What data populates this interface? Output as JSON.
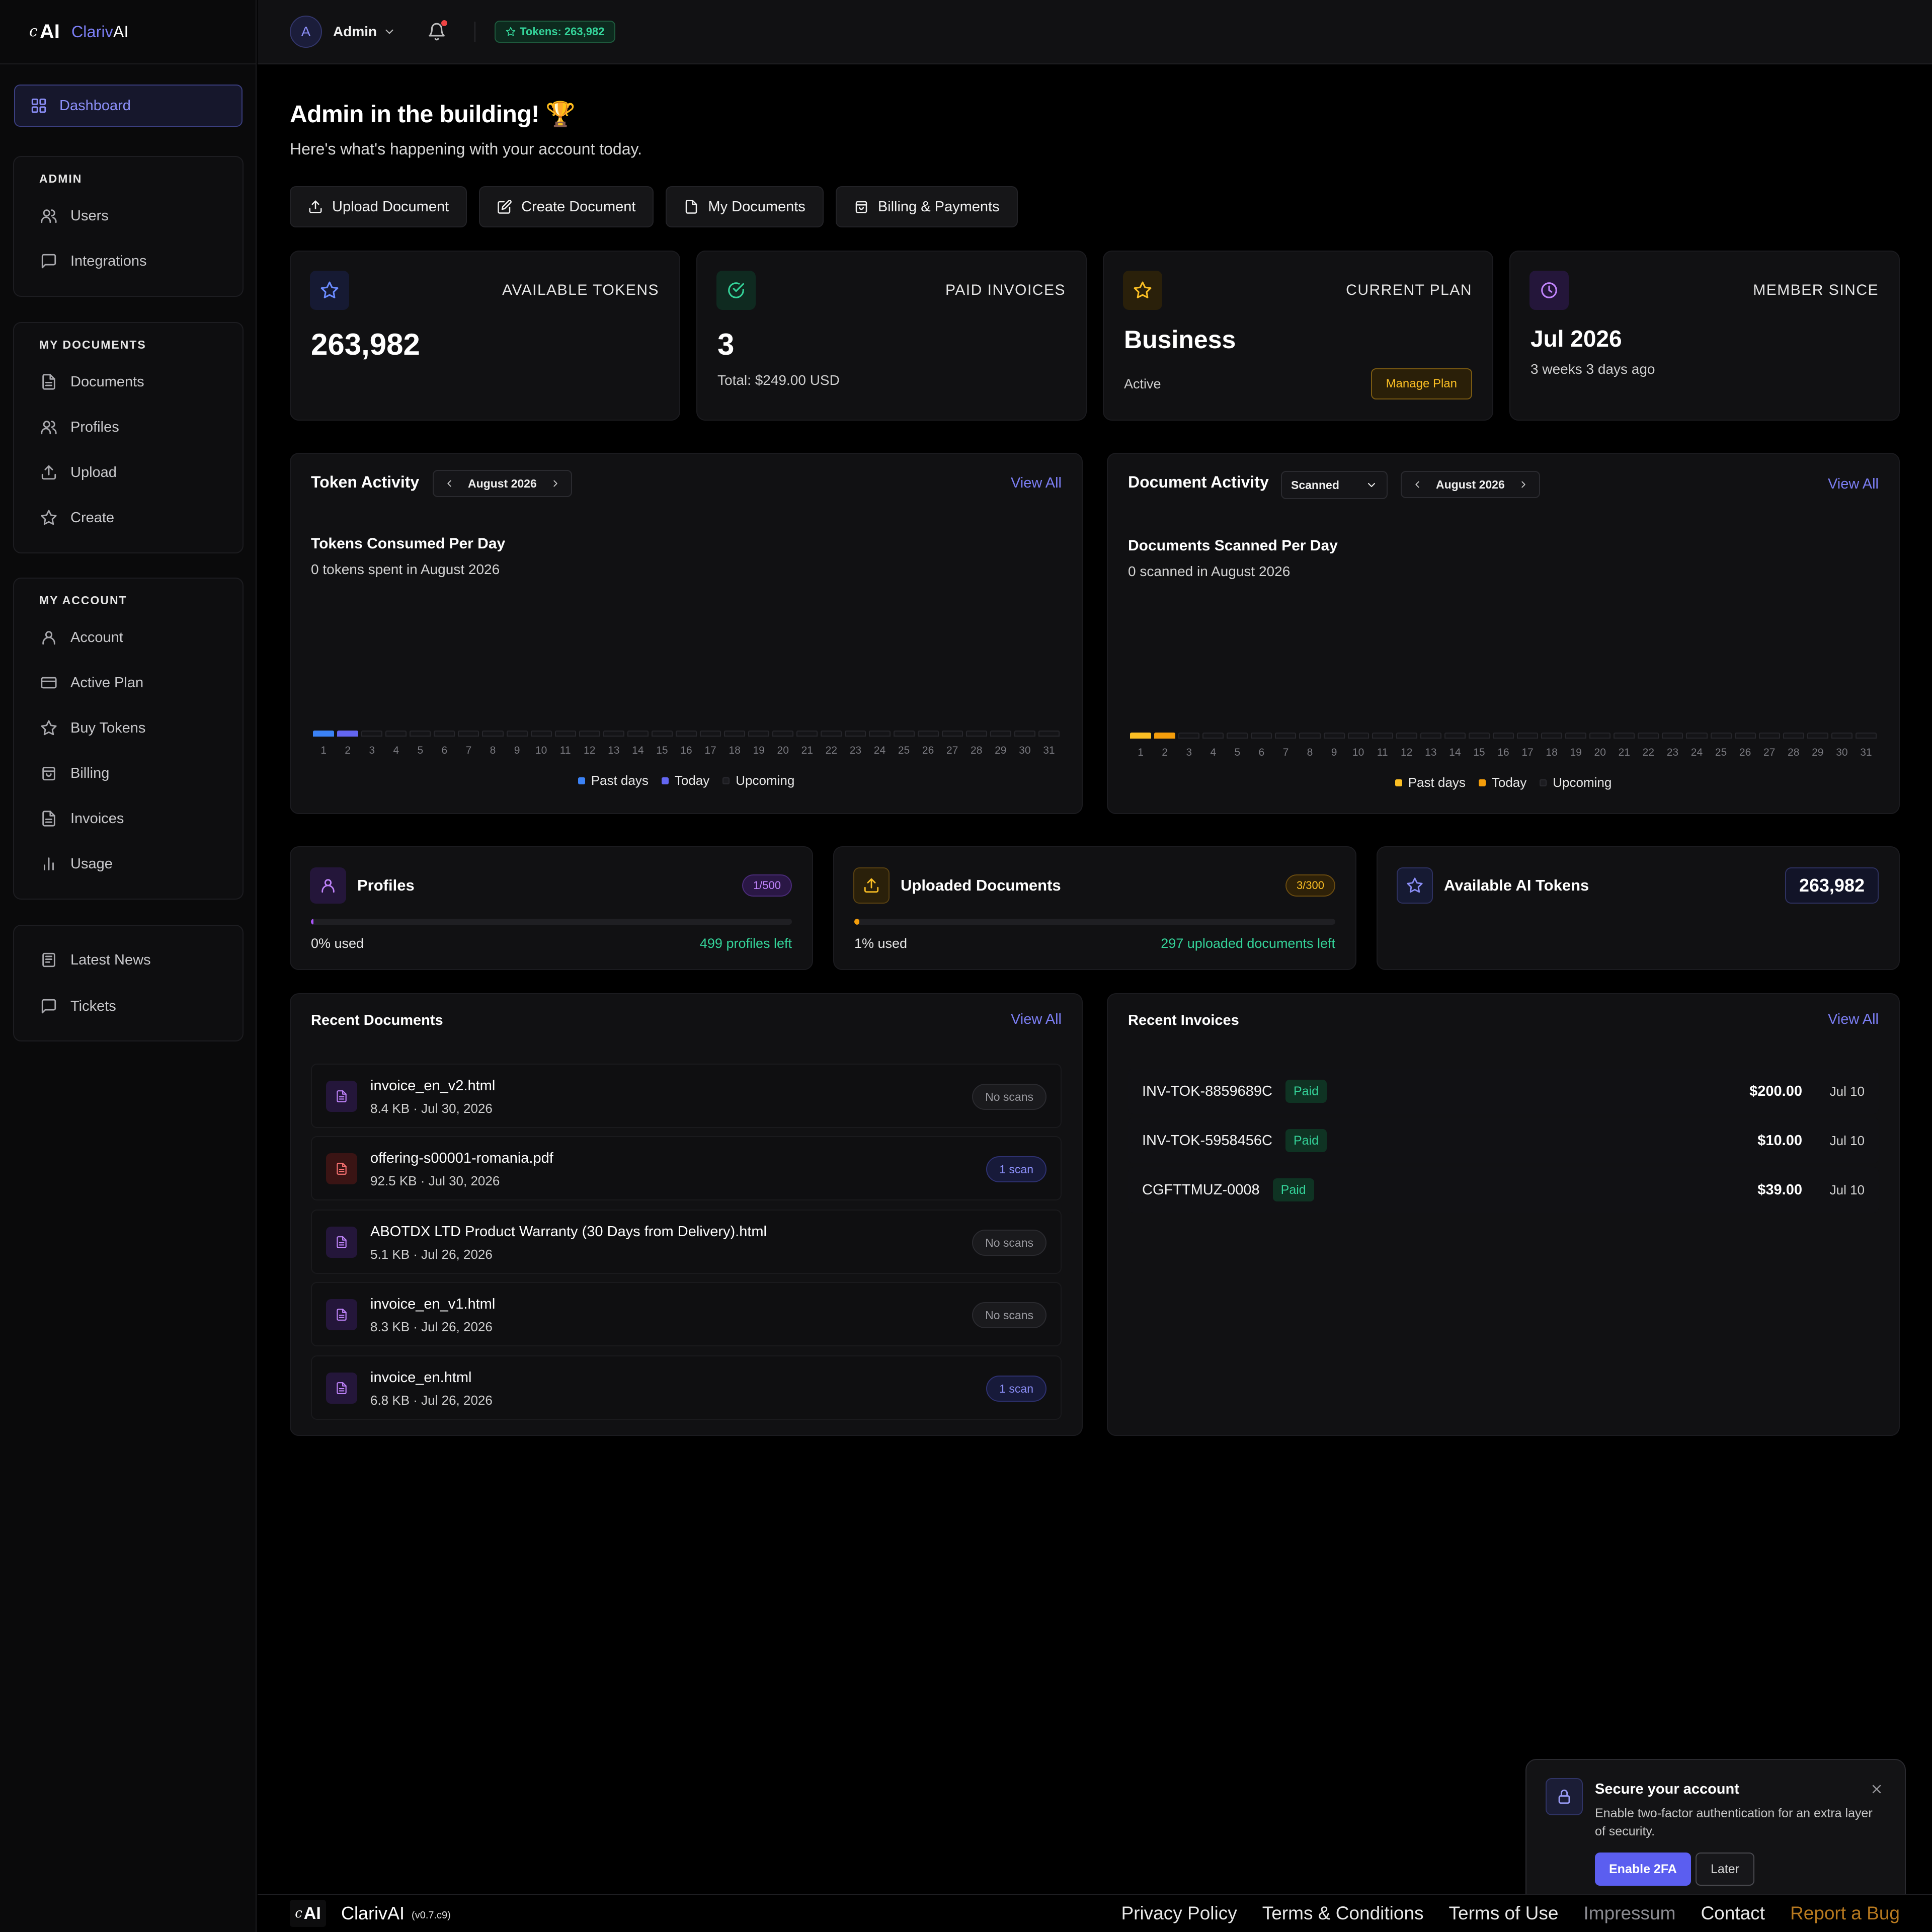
{
  "brand": {
    "name_part1": "Clariv",
    "name_part2": "AI",
    "logo_c": "c",
    "logo_ai": "AI"
  },
  "sidebar": {
    "dashboard": "Dashboard",
    "admin": {
      "title": "ADMIN",
      "items": [
        "Users",
        "Integrations"
      ]
    },
    "my_documents": {
      "title": "MY DOCUMENTS",
      "items": [
        "Documents",
        "Profiles",
        "Upload",
        "Create"
      ]
    },
    "my_account": {
      "title": "MY ACCOUNT",
      "items": [
        "Account",
        "Active Plan",
        "Buy Tokens",
        "Billing",
        "Invoices",
        "Usage"
      ]
    },
    "extra": {
      "items": [
        "Latest News",
        "Tickets"
      ]
    }
  },
  "topbar": {
    "avatar_letter": "A",
    "user": "Admin",
    "tokens": "Tokens: 263,982"
  },
  "header": {
    "greeting": "Admin in the building! 🏆",
    "subtitle": "Here's what's happening with your account today.",
    "actions": [
      "Upload Document",
      "Create Document",
      "My Documents",
      "Billing & Payments"
    ]
  },
  "stats": {
    "tokens": {
      "label": "AVAILABLE TOKENS",
      "value": "263,982"
    },
    "invoices": {
      "label": "PAID INVOICES",
      "value": "3",
      "sub": "Total: $249.00 USD"
    },
    "plan": {
      "label": "CURRENT PLAN",
      "value": "Business",
      "status": "Active",
      "button": "Manage Plan"
    },
    "member": {
      "label": "MEMBER SINCE",
      "value": "Jul 2026",
      "sub": "3 weeks 3 days ago"
    }
  },
  "token_activity": {
    "title": "Token Activity",
    "month": "August 2026",
    "view_all": "View All",
    "heading": "Tokens Consumed Per Day",
    "summary": "0 tokens spent in August 2026",
    "legend": [
      "Past days",
      "Today",
      "Upcoming"
    ]
  },
  "document_activity": {
    "title": "Document Activity",
    "filter": "Scanned",
    "month": "August 2026",
    "view_all": "View All",
    "heading": "Documents Scanned Per Day",
    "summary": "0 scanned in August 2026",
    "legend": [
      "Past days",
      "Today",
      "Upcoming"
    ]
  },
  "chart_data": [
    {
      "type": "bar",
      "title": "Tokens Consumed Per Day",
      "categories": [
        "1",
        "2",
        "3",
        "4",
        "5",
        "6",
        "7",
        "8",
        "9",
        "10",
        "11",
        "12",
        "13",
        "14",
        "15",
        "16",
        "17",
        "18",
        "19",
        "20",
        "21",
        "22",
        "23",
        "24",
        "25",
        "26",
        "27",
        "28",
        "29",
        "30",
        "31"
      ],
      "values": [
        0,
        0,
        0,
        0,
        0,
        0,
        0,
        0,
        0,
        0,
        0,
        0,
        0,
        0,
        0,
        0,
        0,
        0,
        0,
        0,
        0,
        0,
        0,
        0,
        0,
        0,
        0,
        0,
        0,
        0,
        0
      ],
      "day_status": [
        "past",
        "today",
        "upcoming",
        "upcoming",
        "upcoming",
        "upcoming",
        "upcoming",
        "upcoming",
        "upcoming",
        "upcoming",
        "upcoming",
        "upcoming",
        "upcoming",
        "upcoming",
        "upcoming",
        "upcoming",
        "upcoming",
        "upcoming",
        "upcoming",
        "upcoming",
        "upcoming",
        "upcoming",
        "upcoming",
        "upcoming",
        "upcoming",
        "upcoming",
        "upcoming",
        "upcoming",
        "upcoming",
        "upcoming",
        "upcoming"
      ],
      "colors": {
        "past": "#3b82f6",
        "today": "#6366f1",
        "upcoming": "#141417"
      }
    },
    {
      "type": "bar",
      "title": "Documents Scanned Per Day",
      "categories": [
        "1",
        "2",
        "3",
        "4",
        "5",
        "6",
        "7",
        "8",
        "9",
        "10",
        "11",
        "12",
        "13",
        "14",
        "15",
        "16",
        "17",
        "18",
        "19",
        "20",
        "21",
        "22",
        "23",
        "24",
        "25",
        "26",
        "27",
        "28",
        "29",
        "30",
        "31"
      ],
      "values": [
        0,
        0,
        0,
        0,
        0,
        0,
        0,
        0,
        0,
        0,
        0,
        0,
        0,
        0,
        0,
        0,
        0,
        0,
        0,
        0,
        0,
        0,
        0,
        0,
        0,
        0,
        0,
        0,
        0,
        0,
        0
      ],
      "day_status": [
        "past",
        "today",
        "upcoming",
        "upcoming",
        "upcoming",
        "upcoming",
        "upcoming",
        "upcoming",
        "upcoming",
        "upcoming",
        "upcoming",
        "upcoming",
        "upcoming",
        "upcoming",
        "upcoming",
        "upcoming",
        "upcoming",
        "upcoming",
        "upcoming",
        "upcoming",
        "upcoming",
        "upcoming",
        "upcoming",
        "upcoming",
        "upcoming",
        "upcoming",
        "upcoming",
        "upcoming",
        "upcoming",
        "upcoming",
        "upcoming"
      ],
      "colors": {
        "past": "#fbbf24",
        "today": "#f59e0b",
        "upcoming": "#141417"
      }
    }
  ],
  "usage": {
    "profiles": {
      "title": "Profiles",
      "badge": "1/500",
      "used": "0% used",
      "left": "499 profiles left",
      "fraction": 0.002
    },
    "uploads": {
      "title": "Uploaded Documents",
      "badge": "3/300",
      "used": "1% used",
      "left": "297 uploaded documents left",
      "fraction": 0.01
    },
    "ai_tokens": {
      "title": "Available AI Tokens",
      "value": "263,982"
    }
  },
  "recent_documents": {
    "title": "Recent Documents",
    "view_all": "View All",
    "items": [
      {
        "name": "invoice_en_v2.html",
        "meta": "8.4 KB · Jul 30, 2026",
        "scans": "No scans",
        "type": "html"
      },
      {
        "name": "offering-s00001-romania.pdf",
        "meta": "92.5 KB · Jul 30, 2026",
        "scans": "1 scan",
        "type": "pdf"
      },
      {
        "name": "ABOTDX LTD Product Warranty (30 Days from Delivery).html",
        "meta": "5.1 KB · Jul 26, 2026",
        "scans": "No scans",
        "type": "html"
      },
      {
        "name": "invoice_en_v1.html",
        "meta": "8.3 KB · Jul 26, 2026",
        "scans": "No scans",
        "type": "html"
      },
      {
        "name": "invoice_en.html",
        "meta": "6.8 KB · Jul 26, 2026",
        "scans": "1 scan",
        "type": "html"
      }
    ]
  },
  "recent_invoices": {
    "title": "Recent Invoices",
    "view_all": "View All",
    "items": [
      {
        "id": "INV-TOK-8859689C",
        "status": "Paid",
        "amount": "$200.00",
        "date": "Jul 10"
      },
      {
        "id": "INV-TOK-5958456C",
        "status": "Paid",
        "amount": "$10.00",
        "date": "Jul 10"
      },
      {
        "id": "CGFTTMUZ-0008",
        "status": "Paid",
        "amount": "$39.00",
        "date": "Jul 10"
      }
    ]
  },
  "toast": {
    "title": "Secure your account",
    "text": "Enable two-factor authentication for an extra layer of security.",
    "primary": "Enable 2FA",
    "secondary": "Later"
  },
  "footer": {
    "brand": "ClarivAI",
    "version": "(v0.7.c9)",
    "links": [
      "Privacy Policy",
      "Terms & Conditions",
      "Terms of Use",
      "Impressum",
      "Contact",
      "Report a Bug"
    ]
  }
}
